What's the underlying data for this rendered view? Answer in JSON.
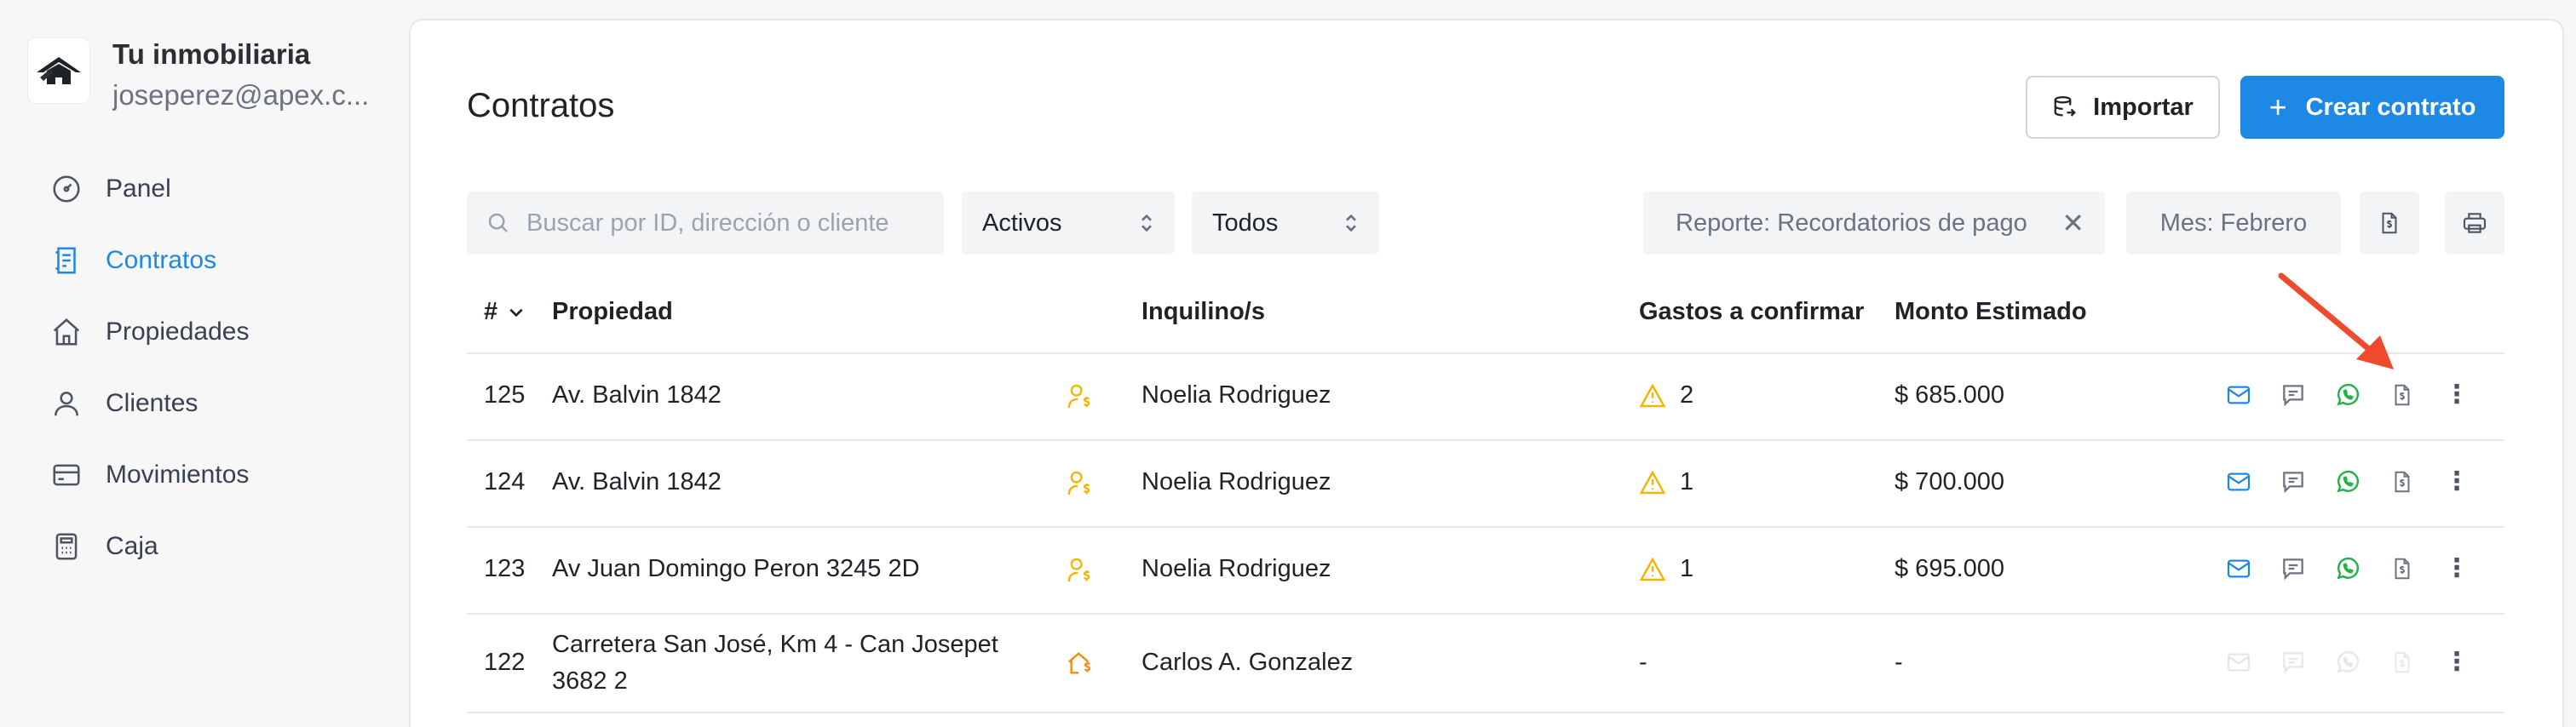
{
  "brand": {
    "name": "Tu inmobiliaria",
    "email": "joseperez@apex.c..."
  },
  "nav": [
    {
      "label": "Panel",
      "icon": "gauge-icon",
      "active": false
    },
    {
      "label": "Contratos",
      "icon": "contract-icon",
      "active": true
    },
    {
      "label": "Propiedades",
      "icon": "house-icon",
      "active": false
    },
    {
      "label": "Clientes",
      "icon": "user-icon",
      "active": false
    },
    {
      "label": "Movimientos",
      "icon": "card-icon",
      "active": false
    },
    {
      "label": "Caja",
      "icon": "calculator-icon",
      "active": false
    }
  ],
  "page": {
    "title": "Contratos",
    "import_label": "Importar",
    "create_label": "Crear contrato"
  },
  "filters": {
    "search_placeholder": "Buscar por ID, dirección o cliente",
    "status": "Activos",
    "type": "Todos",
    "report": "Reporte: Recordatorios de pago",
    "month": "Mes: Febrero"
  },
  "table": {
    "headers": [
      "#",
      "Propiedad",
      "Inquilino/s",
      "Gastos a confirmar",
      "Monto Estimado"
    ],
    "rows": [
      {
        "id": "125",
        "property": "Av. Balvin 1842",
        "tenant": "Noelia Rodriguez",
        "expenses": "2",
        "amount": "$ 685.000",
        "enabled": true
      },
      {
        "id": "124",
        "property": "Av. Balvin 1842",
        "tenant": "Noelia Rodriguez",
        "expenses": "1",
        "amount": "$ 700.000",
        "enabled": true
      },
      {
        "id": "123",
        "property": "Av Juan Domingo Peron 3245 2D",
        "tenant": "Noelia Rodriguez",
        "expenses": "1",
        "amount": "$ 695.000",
        "enabled": true
      },
      {
        "id": "122",
        "property": "Carretera San José, Km 4 - Can Josepet 3682 2",
        "tenant": "Carlos A. Gonzalez",
        "expenses": "-",
        "amount": "-",
        "enabled": false
      }
    ]
  },
  "colors": {
    "accent": "#1e88e5",
    "warning": "#f5b400",
    "whatsapp": "#25b04a",
    "arrow": "#ef4a2e"
  }
}
